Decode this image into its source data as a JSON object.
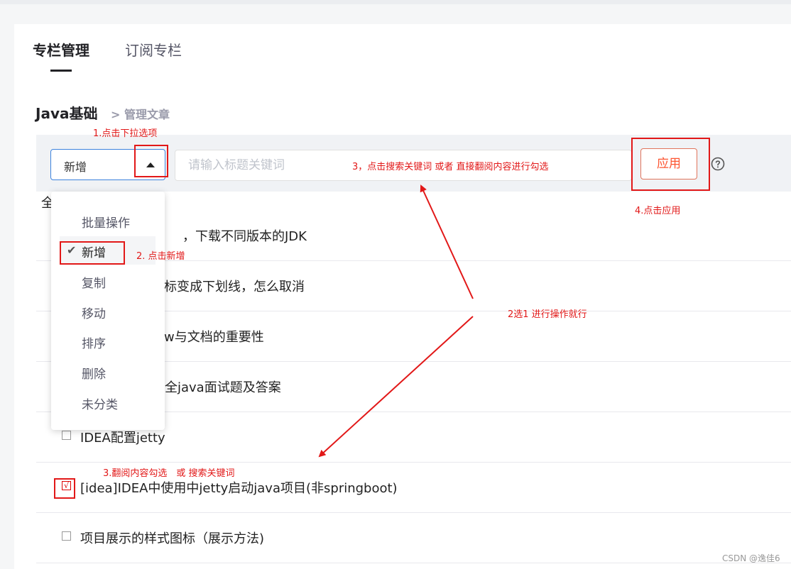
{
  "tabs": [
    {
      "label": "专栏管理",
      "active": true
    },
    {
      "label": "订阅专栏",
      "active": false
    }
  ],
  "page": {
    "title": "Java基础",
    "breadcrumb": "> 管理文章"
  },
  "filter": {
    "select_value": "新增",
    "search_placeholder": "请输入标题关键词",
    "apply_label": "应用",
    "help_icon": "question-circle-icon"
  },
  "select_all_partial": "全",
  "dropdown": {
    "items": [
      {
        "label": "批量操作",
        "selected": false
      },
      {
        "label": "新增",
        "selected": true
      },
      {
        "label": "复制",
        "selected": false
      },
      {
        "label": "移动",
        "selected": false
      },
      {
        "label": "排序",
        "selected": false
      },
      {
        "label": "删除",
        "selected": false
      },
      {
        "label": "未分类",
        "selected": false
      }
    ]
  },
  "articles": [
    {
      "title": "，下载不同版本的JDK",
      "checked": false
    },
    {
      "title": "标变成下划线，怎么取消",
      "checked": false
    },
    {
      "title": "w与文档的重要性",
      "checked": false
    },
    {
      "title": "全java面试题及答案",
      "checked": false
    },
    {
      "title": "IDEA配置jetty",
      "checked": false
    },
    {
      "title": "[idea]IDEA中使用中jetty启动java项目(非springboot)",
      "checked": true
    },
    {
      "title": "项目展示的样式图标（展示方法)",
      "checked": false
    }
  ],
  "annotations": {
    "step1": "1.点击下拉选项",
    "step2": "2. 点击新增",
    "step3_search": "3，点击搜索关键词 或者 直接翻阅内容进行勾选",
    "step3_check": "3.翻阅内容勾选　或 搜索关键词",
    "step4": "4.点击应用",
    "choose": "2选1 进行操作就行",
    "check_mark": "√"
  },
  "watermark": "CSDN @逸佳6",
  "colors": {
    "accent_blue": "#3c82dd",
    "apply_red": "#fc5531",
    "annotation_red": "#e21818"
  }
}
